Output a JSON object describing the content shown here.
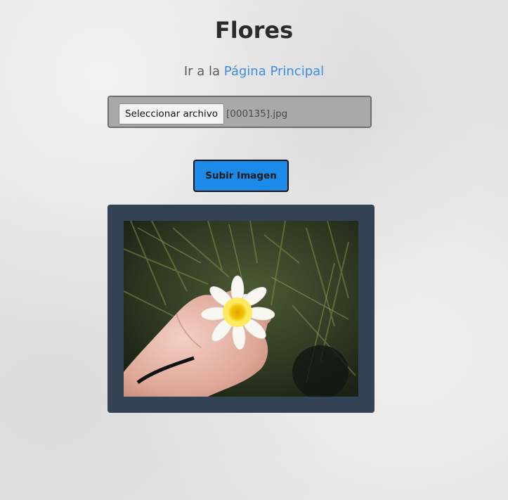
{
  "page": {
    "title": "Flores"
  },
  "nav": {
    "prefix": "Ir a la ",
    "link_label": "Página Principal"
  },
  "upload_form": {
    "file_button_label": "Seleccionar archivo",
    "selected_file": "[000135].jpg",
    "submit_label": "Subir Imagen"
  },
  "image": {
    "subject": "white-yellow-daisy-in-hand-photo"
  },
  "colors": {
    "link": "#3b8ee8",
    "submit_button": "#1b8ae8",
    "frame": "#334355"
  }
}
